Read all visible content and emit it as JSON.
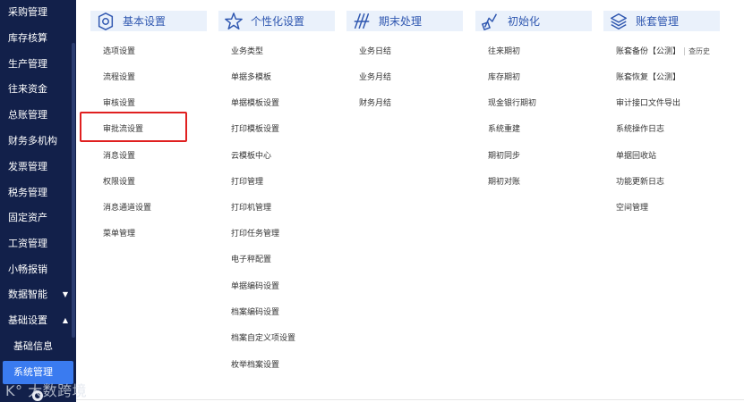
{
  "sidebar": {
    "items": [
      {
        "label": "采购管理"
      },
      {
        "label": "库存核算"
      },
      {
        "label": "生产管理"
      },
      {
        "label": "往来资金"
      },
      {
        "label": "总账管理"
      },
      {
        "label": "财务多机构"
      },
      {
        "label": "发票管理"
      },
      {
        "label": "税务管理"
      },
      {
        "label": "固定资产"
      },
      {
        "label": "工资管理"
      },
      {
        "label": "小畅报销"
      },
      {
        "label": "数据智能",
        "caret": "▼"
      },
      {
        "label": "基础设置",
        "caret": "▲"
      },
      {
        "label": "基础信息"
      },
      {
        "label": "系统管理"
      }
    ],
    "watermark": "大数跨境"
  },
  "columns": [
    {
      "title": "基本设置",
      "icon": "settings-icon",
      "items": [
        "选项设置",
        "流程设置",
        "审核设置",
        "审批流设置",
        "消息设置",
        "权限设置",
        "消息通道设置",
        "菜单管理"
      ]
    },
    {
      "title": "个性化设置",
      "icon": "star-icon",
      "items": [
        "业务类型",
        "单据多模板",
        "单据模板设置",
        "打印模板设置",
        "云模板中心",
        "打印管理",
        "打印机管理",
        "打印任务管理",
        "电子秤配置",
        "单据编码设置",
        "档案编码设置",
        "档案自定义项设置",
        "枚举档案设置"
      ]
    },
    {
      "title": "期末处理",
      "icon": "period-end-icon",
      "items": [
        "业务日结",
        "业务月结",
        "财务月结"
      ]
    },
    {
      "title": "初始化",
      "icon": "initialize-icon",
      "items": [
        "往来期初",
        "库存期初",
        "现金银行期初",
        "系统重建",
        "期初同步",
        "期初对账"
      ]
    },
    {
      "title": "账套管理",
      "icon": "account-set-icon",
      "items": [
        "账套备份【公测】",
        "账套恢复【公测】",
        "审计接口文件导出",
        "系统操作日志",
        "单据回收站",
        "功能更新日志",
        "空间管理"
      ],
      "history_label": "查历史"
    }
  ],
  "highlight": {
    "column": 0,
    "item": 3,
    "color": "#e02020"
  },
  "colors": {
    "sidebar_bg": "#12204a",
    "active": "#3a7bf0",
    "header_bg": "#eaf1fb",
    "header_text": "#2f57b0"
  }
}
